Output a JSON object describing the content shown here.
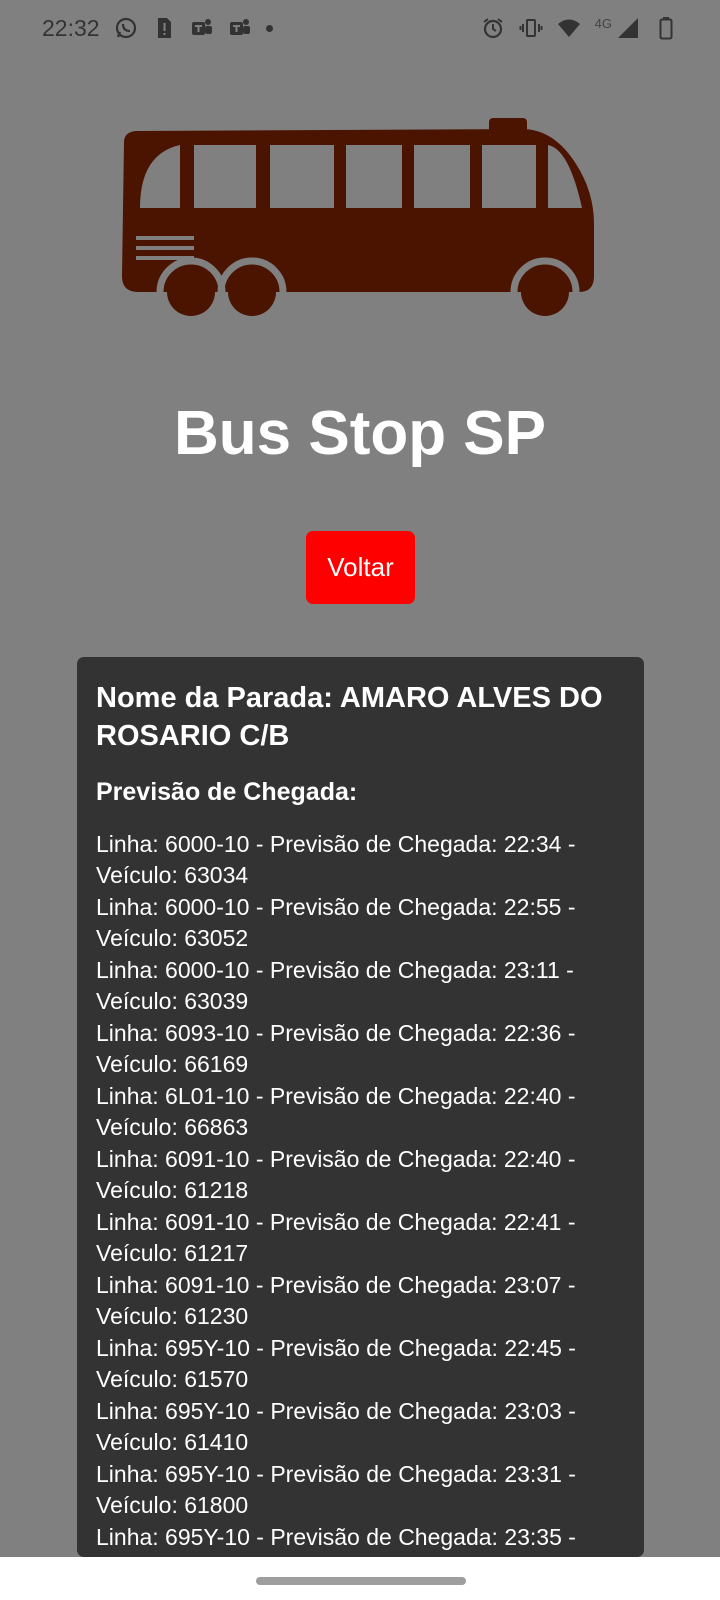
{
  "status_bar": {
    "time": "22:32",
    "network": "4G",
    "left_icons": [
      "whatsapp-icon",
      "sim-alert-icon",
      "teams-icon",
      "teams-icon",
      "more-dot-icon"
    ],
    "right_icons": [
      "alarm-icon",
      "vibrate-icon",
      "wifi-icon",
      "signal-icon",
      "battery-icon"
    ]
  },
  "header": {
    "logo_icon": "bus-icon",
    "logo_color": "#4a1400",
    "title": "Bus Stop SP"
  },
  "actions": {
    "back_label": "Voltar",
    "back_color": "#ff0000"
  },
  "stop": {
    "name": "Nome da Parada: AMARO ALVES DO ROSARIO C/B",
    "section_title": "Previsão de Chegada:",
    "arrivals": [
      "Linha: 6000-10 - Previsão de Chegada: 22:34 - Veículo: 63034",
      "Linha: 6000-10 - Previsão de Chegada: 22:55 - Veículo: 63052",
      "Linha: 6000-10 - Previsão de Chegada: 23:11 - Veículo: 63039",
      "Linha: 6093-10 - Previsão de Chegada: 22:36 - Veículo: 66169",
      "Linha: 6L01-10 - Previsão de Chegada: 22:40 - Veículo: 66863",
      "Linha: 6091-10 - Previsão de Chegada: 22:40 - Veículo: 61218",
      "Linha: 6091-10 - Previsão de Chegada: 22:41 - Veículo: 61217",
      "Linha: 6091-10 - Previsão de Chegada: 23:07 - Veículo: 61230",
      "Linha: 695Y-10 - Previsão de Chegada: 22:45 - Veículo: 61570",
      "Linha: 695Y-10 - Previsão de Chegada: 23:03 - Veículo: 61410",
      "Linha: 695Y-10 - Previsão de Chegada: 23:31 - Veículo: 61800",
      "Linha: 695Y-10 - Previsão de Chegada: 23:35 -"
    ]
  },
  "colors": {
    "background": "#808080",
    "card": "#333333",
    "text": "#ffffff"
  }
}
